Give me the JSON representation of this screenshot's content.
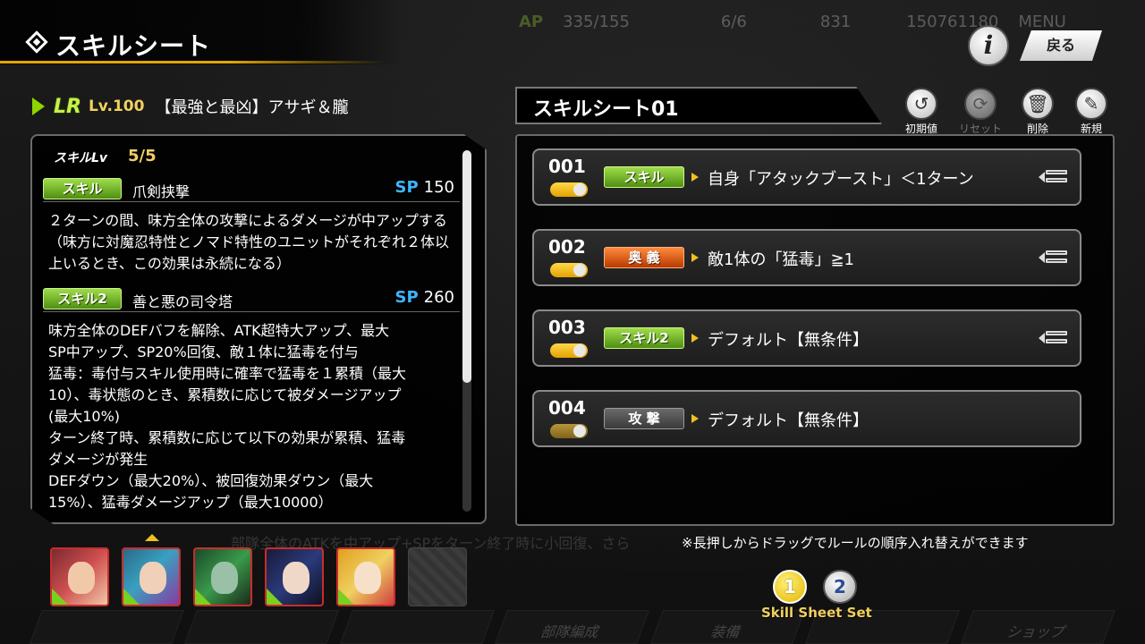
{
  "header": {
    "title": "スキルシート",
    "back_label": "戻る",
    "info_label": "i"
  },
  "background_hud": {
    "ap_label": "AP",
    "ap_value": "335/155",
    "bp_value": "6/6",
    "gem_value": "831",
    "coin_value": "150761180",
    "menu_label": "MENU",
    "ghost_text": "部隊全体のATKを中アップ+SPをターン終了時に小回復、さら",
    "nav_items": [
      "部隊編成",
      "装備",
      "ショップ"
    ]
  },
  "character": {
    "rarity": "LR",
    "level": "Lv.100",
    "name": "【最強と最凶】アサギ＆朧"
  },
  "skills_panel": {
    "skill_lv_label": "スキルLv",
    "skill_lv_value": "5/5",
    "skill1": {
      "tag": "スキル",
      "name": "爪剣挟撃",
      "sp_label": "SP",
      "sp_value": "150",
      "description": "２ターンの間、味方全体の攻撃によるダメージが中アップする（味方に対魔忍特性とノマド特性のユニットがそれぞれ２体以上いるとき、この効果は永続になる）"
    },
    "skill2": {
      "tag": "スキル2",
      "name": "善と悪の司令塔",
      "sp_label": "SP",
      "sp_value": "260",
      "description_lines": [
        "味方全体のDEFバフを解除、ATK超特大アップ、最大",
        "SP中アップ、SP20%回復、敵１体に猛毒を付与",
        "猛毒：毒付与スキル使用時に確率で猛毒を１累積（最大",
        "10）、毒状態のとき、累積数に応じて被ダメージアップ",
        "(最大10%)",
        "ターン終了時、累積数に応じて以下の効果が累積、猛毒",
        "ダメージが発生",
        "DEFダウン（最大20%）、被回復効果ダウン（最大",
        "15%）、猛毒ダメージアップ（最大10000）"
      ]
    }
  },
  "sheet": {
    "title": "スキルシート01",
    "actions": [
      {
        "label": "初期値",
        "icon": "history-icon",
        "glyph": "↺"
      },
      {
        "label": "リセット",
        "icon": "reset-icon",
        "glyph": "⟳"
      },
      {
        "label": "削除",
        "icon": "trash-icon",
        "glyph": "🗑"
      },
      {
        "label": "新規",
        "icon": "pencil-icon",
        "glyph": "✎"
      }
    ],
    "rules": [
      {
        "num": "001",
        "tag": "スキル",
        "tag_color": "green",
        "condition": "自身「アタックブースト」＜1ターン",
        "enabled": true
      },
      {
        "num": "002",
        "tag": "奥 義",
        "tag_color": "orange",
        "condition": "敵1体の「猛毒」≧1",
        "enabled": true
      },
      {
        "num": "003",
        "tag": "スキル2",
        "tag_color": "green",
        "condition": "デフォルト【無条件】",
        "enabled": true
      },
      {
        "num": "004",
        "tag": "攻 撃",
        "tag_color": "gray",
        "condition": "デフォルト【無条件】",
        "enabled": true
      }
    ],
    "note": "※長押しからドラッグでルールの順序入れ替えができます"
  },
  "skill_sheet_set": {
    "label": "Skill Sheet Set",
    "options": [
      "1",
      "2"
    ],
    "selected": "1"
  },
  "colors": {
    "accent_gold": "#e3a700",
    "skill_green": "#7ac020",
    "sp_blue": "#3fb5ff",
    "ougi_orange": "#e05a10"
  }
}
